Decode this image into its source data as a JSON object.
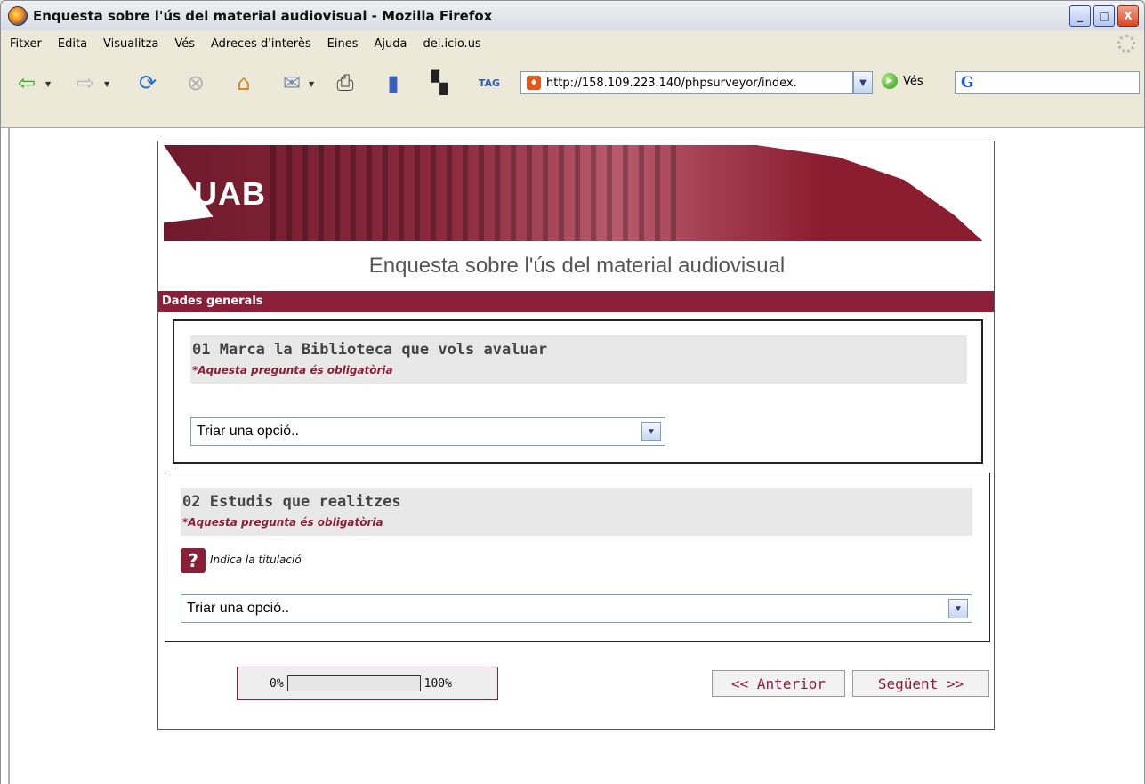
{
  "window": {
    "title": "Enquesta sobre l'ús del material audiovisual - Mozilla Firefox",
    "minimize_label": "_",
    "maximize_label": "□",
    "close_label": "X"
  },
  "menu": {
    "items": [
      {
        "label": "Fitxer"
      },
      {
        "label": "Edita"
      },
      {
        "label": "Visualitza"
      },
      {
        "label": "Vés"
      },
      {
        "label": "Adreces d'interès"
      },
      {
        "label": "Eines"
      },
      {
        "label": "Ajuda"
      },
      {
        "label": "del.icio.us"
      }
    ]
  },
  "toolbar": {
    "icons": [
      "back-icon",
      "forward-icon",
      "reload-icon",
      "stop-icon",
      "home-icon",
      "mail-icon",
      "print-icon",
      "bookmark-icon",
      "delicious-icon",
      "tag-icon"
    ],
    "tag_label": "TAG",
    "url": "http://158.109.223.140/phpsurveyor/index.",
    "go_label": "Vés",
    "search_logo": "G"
  },
  "banner": {
    "logo_text": "UAB"
  },
  "survey": {
    "title": "Enquesta sobre l'ús del material audiovisual",
    "group": "Dades generals",
    "questions": [
      {
        "text": "01 Marca la Biblioteca que vols avaluar",
        "mandatory": "*Aquesta pregunta és obligatòria",
        "select_value": "Triar una opció.."
      },
      {
        "text": "02 Estudis que realitzes",
        "mandatory": "*Aquesta pregunta és obligatòria",
        "help_icon": "?",
        "help": "Indica la titulació",
        "select_value": "Triar una opció.."
      }
    ],
    "progress": {
      "min_label": "0%",
      "max_label": "100%",
      "value": 0
    },
    "prev_label": "<< Anterior",
    "next_label": "Següent >>"
  },
  "colors": {
    "brand": "#8a1f3a"
  }
}
